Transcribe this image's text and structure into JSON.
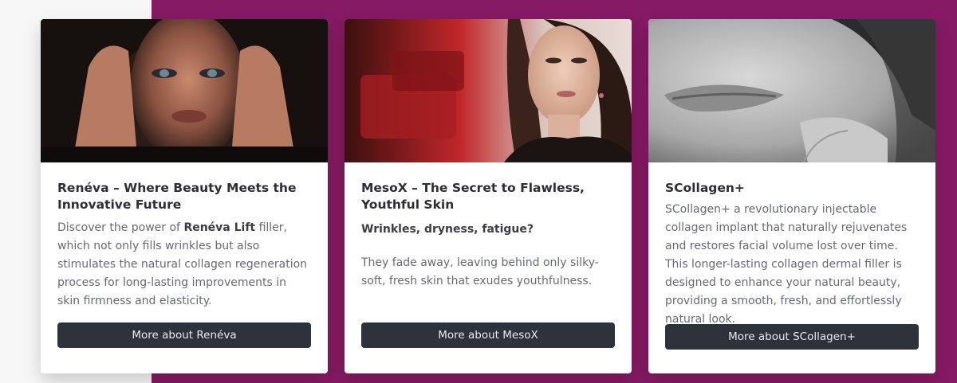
{
  "cards": [
    {
      "title": "Renéva – Where Beauty Meets the Innovative Future",
      "desc_pre": "Discover the power of ",
      "desc_bold": "Renéva Lift",
      "desc_post": " filler, which not only fills wrinkles but also stimulates the natural collagen regeneration process for long-lasting improvements in skin firmness and elasticity.",
      "button": "More about Renéva"
    },
    {
      "title": "MesoX – The Secret to Flawless, Youthful Skin",
      "subtitle": "Wrinkles, dryness, fatigue?",
      "desc": "They fade away, leaving behind only silky-soft, fresh skin that exudes youthfulness.",
      "button": "More about MesoX"
    },
    {
      "title": "SCollagen+",
      "desc": "SCollagen+ a revolutionary injectable collagen implant that naturally rejuvenates and restores facial volume lost over time. This longer-lasting collagen dermal filler is designed to enhance your natural beauty, providing a smooth, fresh, and effortlessly natural look.",
      "button": "More about SCollagen+"
    }
  ],
  "colors": {
    "page_background": "#f7f7f8",
    "section_background": "#861a64",
    "card_background": "#ffffff",
    "button_background": "#2e323b",
    "button_text": "#e8e9ec",
    "title_text": "#2d2f36",
    "body_text": "#666a72"
  }
}
